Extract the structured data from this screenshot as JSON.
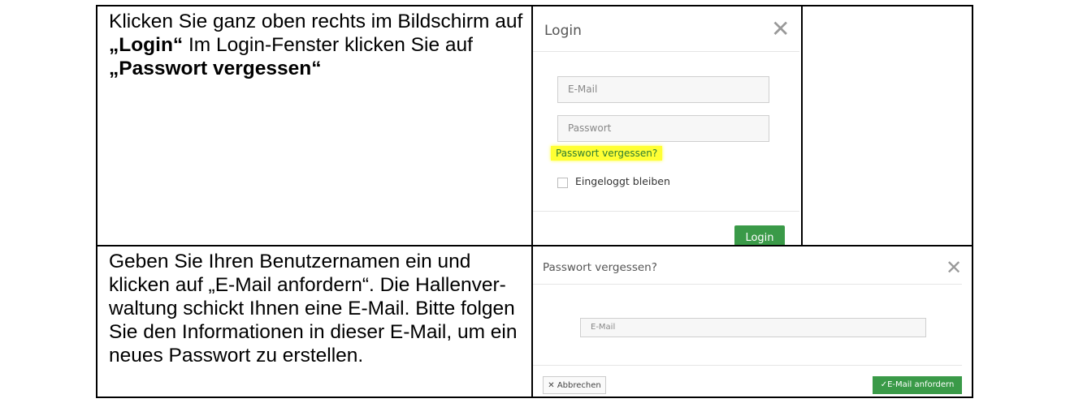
{
  "step1": {
    "text_before_login": "Klicken Sie ganz oben rechts im Bildschirm auf ",
    "login_quoted": "„Login“",
    "text_middle": " Im Login-Fenster klicken Sie auf ",
    "forgot_quoted": "„Passwort vergessen“",
    "modal": {
      "title": "Login",
      "email_placeholder": "E-Mail",
      "password_placeholder": "Passwort",
      "forgot_link": "Passwort vergessen?",
      "remember_label": "Eingeloggt bleiben",
      "login_button": "Login"
    }
  },
  "step2": {
    "text": "Geben Sie Ihren Benutzernamen ein und klicken auf „E-Mail anfordern“. Die Hallenver-waltung schickt Ihnen eine E-Mail. Bitte folgen Sie den Informationen in dieser E-Mail, um ein neues Passwort zu erstellen.",
    "modal": {
      "title": "Passwort vergessen?",
      "email_placeholder": "E-Mail",
      "cancel_button": "Abbrechen",
      "request_button": "E-Mail anfordern"
    }
  },
  "colors": {
    "primary_green": "#3a9a48",
    "highlight": "#ffff33"
  }
}
